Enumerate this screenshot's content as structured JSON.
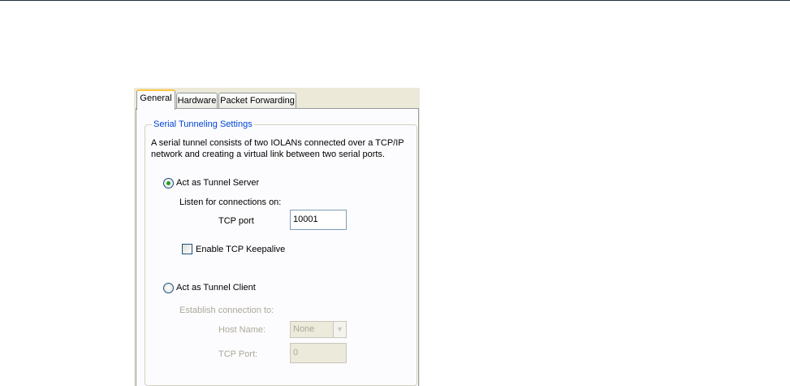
{
  "tabs": [
    {
      "label": "General",
      "active": true
    },
    {
      "label": "Hardware",
      "active": false
    },
    {
      "label": "Packet Forwarding",
      "active": false
    }
  ],
  "group": {
    "title": "Serial Tunneling Settings",
    "description_line1": "A serial tunnel consists of two IOLANs connected over a TCP/IP",
    "description_line2": "network and creating a virtual link between two serial ports."
  },
  "server": {
    "radio_label": "Act as Tunnel Server",
    "selected": true,
    "listen_label": "Listen for connections on:",
    "tcp_port_label": "TCP port",
    "tcp_port_value": "10001",
    "keepalive_label": "Enable TCP Keepalive",
    "keepalive_checked": false
  },
  "client": {
    "radio_label": "Act as Tunnel Client",
    "selected": false,
    "establish_label": "Establish connection to:",
    "host_name_label": "Host Name:",
    "host_name_value": "None",
    "tcp_port_label": "TCP Port:",
    "tcp_port_value": "0"
  },
  "colors": {
    "legend": "#0046d5",
    "active_tab_highlight": "#ffc83c",
    "radio_dot": "#21a121",
    "disabled_text": "#aca899"
  }
}
